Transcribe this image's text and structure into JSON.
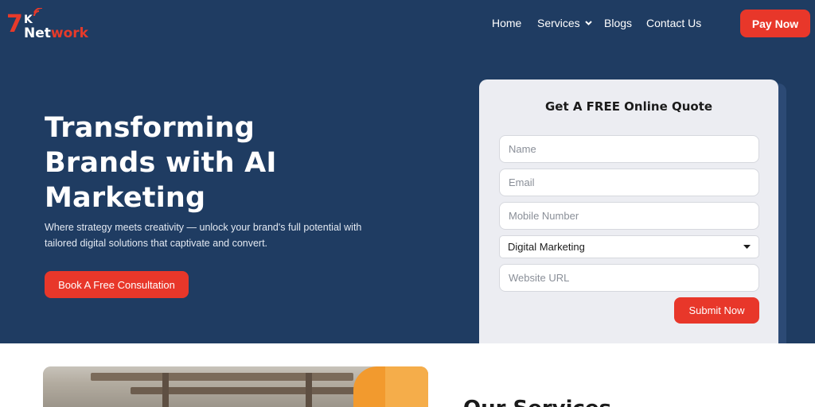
{
  "brand": {
    "logo_number": "7",
    "logo_letter": "K",
    "logo_word_first": "Net",
    "logo_word_second": "work"
  },
  "nav": {
    "home": "Home",
    "services": "Services",
    "blogs": "Blogs",
    "contact": "Contact Us",
    "pay_label": "Pay Now"
  },
  "hero": {
    "title": "Transforming Brands with AI Marketing",
    "subtitle": "Where strategy meets creativity — unlock your brand's full potential with tailored digital solutions that captivate and convert.",
    "cta_label": "Book A Free Consultation"
  },
  "quote_form": {
    "title": "Get A FREE Online Quote",
    "name_placeholder": "Name",
    "email_placeholder": "Email",
    "mobile_placeholder": "Mobile Number",
    "service_selected": "Digital Marketing",
    "website_placeholder": "Website URL",
    "submit_label": "Submit Now"
  },
  "services_section": {
    "heading": "Our Services"
  },
  "colors": {
    "hero_bg": "#1f3c62",
    "accent": "#e8372a",
    "card_bg": "#ecedf2"
  },
  "icons": {
    "services_dropdown": "chevron-down-icon",
    "select_arrow": "caret-down-icon",
    "logo_signal": "signal-waves-icon"
  }
}
